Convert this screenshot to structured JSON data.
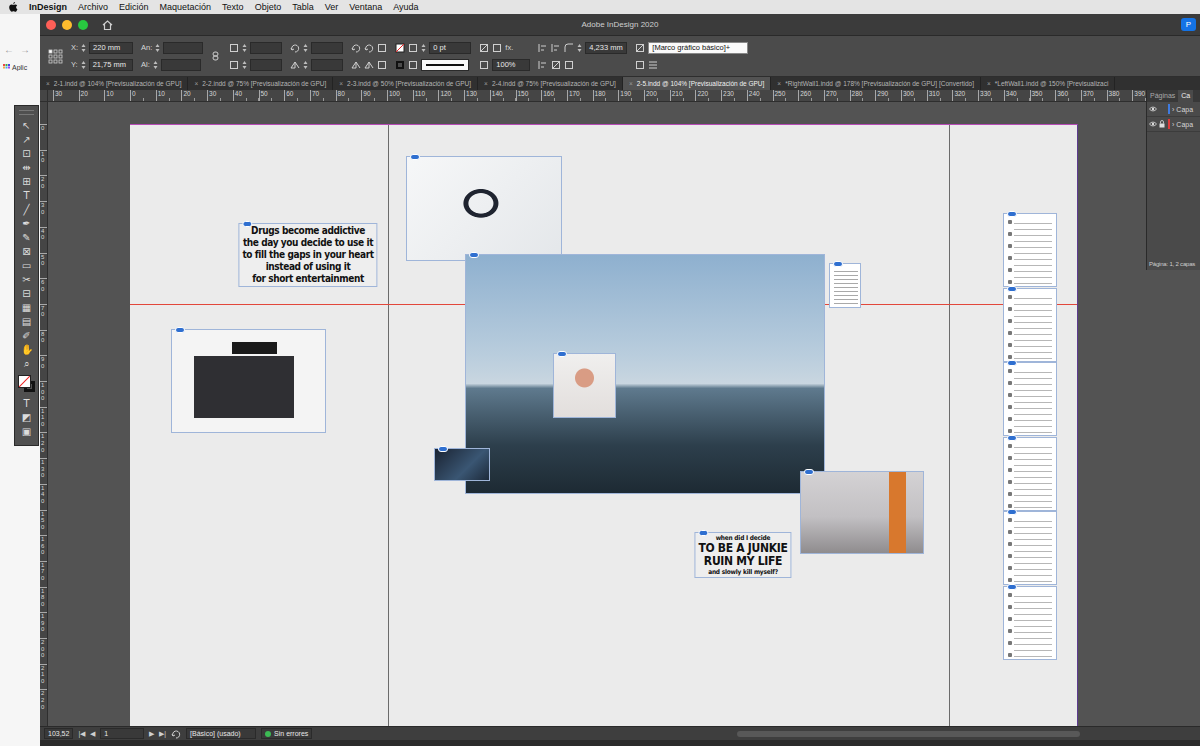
{
  "menubar": {
    "app": "InDesign",
    "items": [
      "Archivo",
      "Edición",
      "Maquetación",
      "Texto",
      "Objeto",
      "Tabla",
      "Ver",
      "Ventana",
      "Ayuda"
    ]
  },
  "browser": {
    "back": "←",
    "forward": "→",
    "bookmarks": "Aplic"
  },
  "window": {
    "title": "Adobe InDesign 2020",
    "share": "P"
  },
  "control_panel": {
    "x_label": "X:",
    "x": "220 mm",
    "y_label": "Y:",
    "y": "21,75 mm",
    "w_label": "An:",
    "h_label": "Al:",
    "stroke_weight": "0 pt",
    "fx": "fx.",
    "scale": "100%",
    "corner": "4,233 mm",
    "object_style": "[Marco gráfico básico]+"
  },
  "tabs": [
    {
      "label": "2-1.indd @ 104% [Previsualización de GPU]",
      "close": "×",
      "selected": false
    },
    {
      "label": "2-2.indd @ 75% [Previsualización de GPU]",
      "close": "×",
      "selected": false
    },
    {
      "label": "2-3.indd @ 50% [Previsualización de GPU]",
      "close": "×",
      "selected": false
    },
    {
      "label": "2-4.indd @ 75% [Previsualización de GPU]",
      "close": "×",
      "selected": false
    },
    {
      "label": "2-5.indd @ 104% [Previsualización de GPU]",
      "close": "×",
      "selected": true
    },
    {
      "label": "*RightWall1.indd @ 178% [Previsualización de GPU] [Convertido]",
      "close": "×",
      "selected": false
    },
    {
      "label": "*LeftWall1.indd @ 150% [Previsualizaci",
      "close": "×",
      "selected": false
    }
  ],
  "rulers": {
    "horizontal": [
      "30",
      "20",
      "10",
      "0",
      "10",
      "20",
      "30",
      "40",
      "50",
      "60",
      "70",
      "80",
      "90",
      "100",
      "110",
      "120",
      "130",
      "140",
      "150",
      "160",
      "170",
      "180",
      "190",
      "200",
      "210",
      "220",
      "230",
      "240",
      "250",
      "260",
      "270",
      "280",
      "290",
      "300",
      "310",
      "320",
      "330",
      "340",
      "350",
      "360",
      "370",
      "380",
      "390"
    ],
    "vertical": [
      "0",
      "10",
      "20",
      "30",
      "40",
      "50",
      "60",
      "70",
      "80",
      "90",
      "100",
      "110",
      "120",
      "130",
      "140",
      "150",
      "160",
      "170",
      "180",
      "190",
      "200",
      "210",
      "220"
    ]
  },
  "toolbar": {
    "tools": [
      "↖",
      "↗",
      "⊡",
      "⇹",
      "⊞",
      "T",
      "╱",
      "✒",
      "✎",
      "⊠",
      "▭",
      "✂",
      "⊟",
      "▦",
      "▤",
      "✐",
      "✋",
      "⌕"
    ],
    "bottom": [
      "T",
      "◩",
      "▣"
    ]
  },
  "document": {
    "quote": {
      "lines": [
        "Drugs become addictive",
        "the day you decide to use it",
        "to fill the gaps in your heart",
        "instead of using it",
        "for short entertainment"
      ]
    },
    "caption": {
      "lines": [
        {
          "text": "when did I decide",
          "kind": "small"
        },
        {
          "text": "TO BE A JUNKIE",
          "kind": "big"
        },
        {
          "text": "RUIN MY LIFE",
          "kind": "big"
        },
        {
          "text": "and slowly kill myself?",
          "kind": "small"
        }
      ]
    }
  },
  "layers_panel": {
    "tabs": [
      {
        "label": "Páginas",
        "selected": false
      },
      {
        "label": "Ca",
        "selected": true
      }
    ],
    "layers": [
      {
        "name": "Capa",
        "expand": "›",
        "visible": true,
        "locked": false,
        "color": "#3f7be0"
      },
      {
        "name": "Capa",
        "expand": "›",
        "visible": true,
        "locked": true,
        "color": "#e03a3a"
      }
    ],
    "footer": "Página: 1, 2 capas"
  },
  "status_bar": {
    "zoom": "103,52",
    "first": "|◀",
    "prev": "◀",
    "page": "1",
    "next": "▶",
    "last": "▶|",
    "master": "[Básico] (usado)",
    "preflight": "Sin errores",
    "preflight_ok": true
  }
}
